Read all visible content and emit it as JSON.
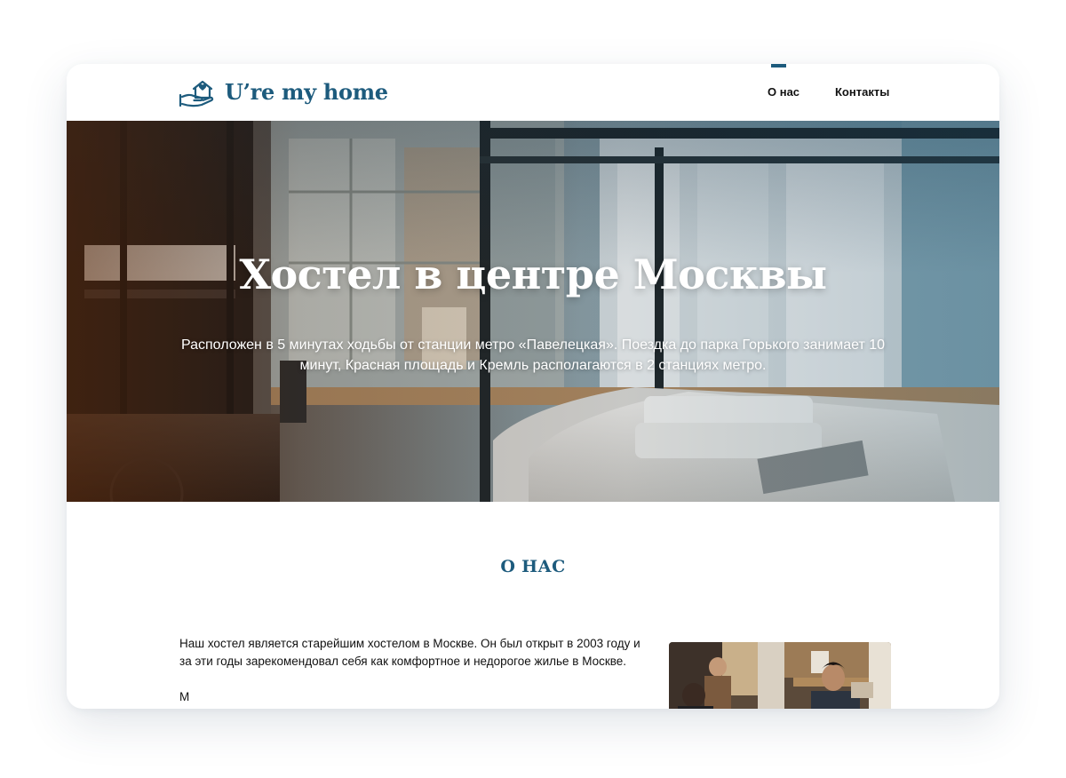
{
  "header": {
    "logo_text": "U’re my home",
    "nav": [
      {
        "label": "О нас",
        "active": true
      },
      {
        "label": "Контакты",
        "active": false
      }
    ]
  },
  "hero": {
    "title": "Хостел в центре Москвы",
    "subtitle": "Расположен в 5 минутах ходьбы от станции метро «Павелецкая». Поездка до парка Горького занимает 10 минут, Красная площадь и Кремль располагаются в 2 станциях метро."
  },
  "about": {
    "title": "О НАС",
    "paragraphs": [
      "Наш хостел является старейшим хостелом в Москве. Он был открыт в 2003 году и за эти годы зарекомендовал себя как комфортное и недорогое жилье в Москве.",
      "М"
    ]
  },
  "colors": {
    "brand": "#1d5b7d",
    "text": "#111111"
  },
  "icons": {
    "logo": "hand-holding-house-heart-icon"
  }
}
